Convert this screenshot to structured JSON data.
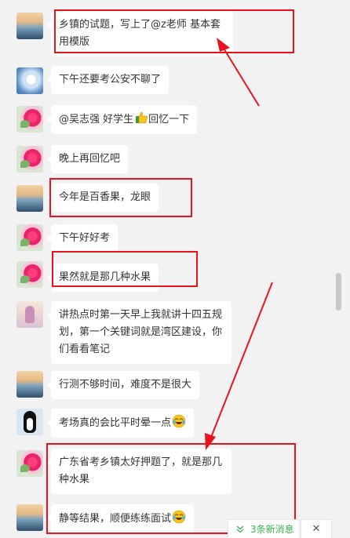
{
  "messages": [
    {
      "avatar": "sunset-avatar",
      "text": "乡镇的试题，写上了@z老师 基本套用模版"
    },
    {
      "avatar": "dandelion-avatar",
      "text": "下午还要考公安不聊了"
    },
    {
      "avatar": "flower-avatar",
      "text": "@吴志强 好学生",
      "emoji": "thumbs-up-icon",
      "text_after": "回忆一下"
    },
    {
      "avatar": "flower-avatar",
      "text": "晚上再回忆吧"
    },
    {
      "avatar": "sunset-avatar",
      "text": "今年是百香果，龙眼"
    },
    {
      "avatar": "flower-avatar",
      "text": "下午好好考"
    },
    {
      "avatar": "flower-avatar",
      "text": "果然就是那几种水果"
    },
    {
      "avatar": "girl-avatar",
      "text": "讲热点时第一天早上我就讲十四五规划，第一个关键词就是湾区建设，你们看看笔记"
    },
    {
      "avatar": "sunset-avatar",
      "text": "行测不够时间，难度不是很大"
    },
    {
      "avatar": "penguin-avatar",
      "text": "考场真的会比平时晕一点",
      "emoji": "crying-laugh-icon"
    },
    {
      "avatar": "flower-avatar",
      "text": "广东省考乡镇太好押题了，就是那几种水果"
    },
    {
      "avatar": "sunset-avatar",
      "text": "静等结果，顺便练练面试",
      "emoji": "crying-laugh-icon"
    }
  ],
  "new_message_bar": {
    "label": "3条新消息",
    "close": "✕"
  },
  "colors": {
    "annotation": "#e8141d",
    "new_message": "#38b54a",
    "bubble": "#ffffff",
    "background": "#f2f2f2"
  }
}
